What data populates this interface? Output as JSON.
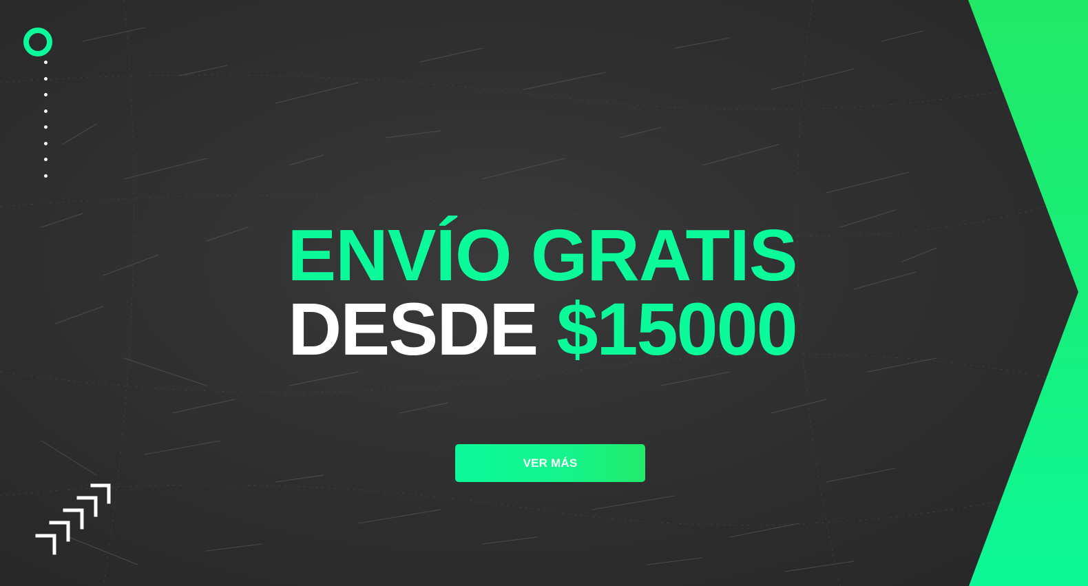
{
  "banner": {
    "headline_line1": "ENVÍO GRATIS",
    "headline_line2_white": "DESDE",
    "headline_line2_green": "$15000",
    "cta_label": "VER MÁS"
  },
  "colors": {
    "background": "#2f2f30",
    "accent_green": "#0bfb9b",
    "chevron_green": "#1fea66",
    "text_white": "#ffffff"
  },
  "icons": {
    "top_left": "ring-icon",
    "left_rail": "dotted-line",
    "bottom_left": "stepped-corners-icon",
    "right_edge": "chevron-shape"
  }
}
